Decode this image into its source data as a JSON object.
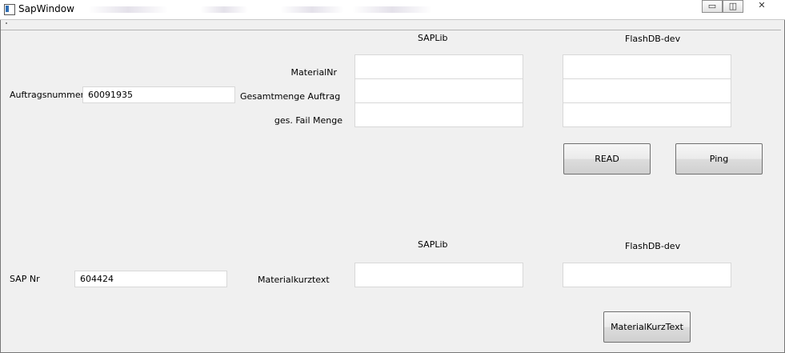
{
  "window": {
    "title": "SapWindow",
    "controls": {
      "minimize": "▭",
      "restore": "◫",
      "close": "✕"
    }
  },
  "top_section": {
    "col1_header": "SAPLib",
    "col2_header": "FlashDB-dev",
    "auftragsnummer_label": "Auftragsnummer",
    "auftragsnummer_value": "60091935",
    "materialnr_label": "MaterialNr",
    "gesamtmenge_label": "Gesamtmenge Auftrag",
    "failmenge_label": "ges. Fail Menge",
    "saplib_materialnr": "",
    "saplib_gesamtmenge": "",
    "saplib_failmenge": "",
    "flashdb_materialnr": "",
    "flashdb_gesamtmenge": "",
    "flashdb_failmenge": "",
    "read_button": "READ",
    "ping_button": "Ping"
  },
  "bottom_section": {
    "col1_header": "SAPLib",
    "col2_header": "FlashDB-dev",
    "sapnr_label": "SAP Nr",
    "sapnr_value": "604424",
    "materialkurztext_label": "Materialkurztext",
    "saplib_materialkurztext": "",
    "flashdb_materialkurztext": "",
    "materialkurztext_button": "MaterialKurzText"
  }
}
